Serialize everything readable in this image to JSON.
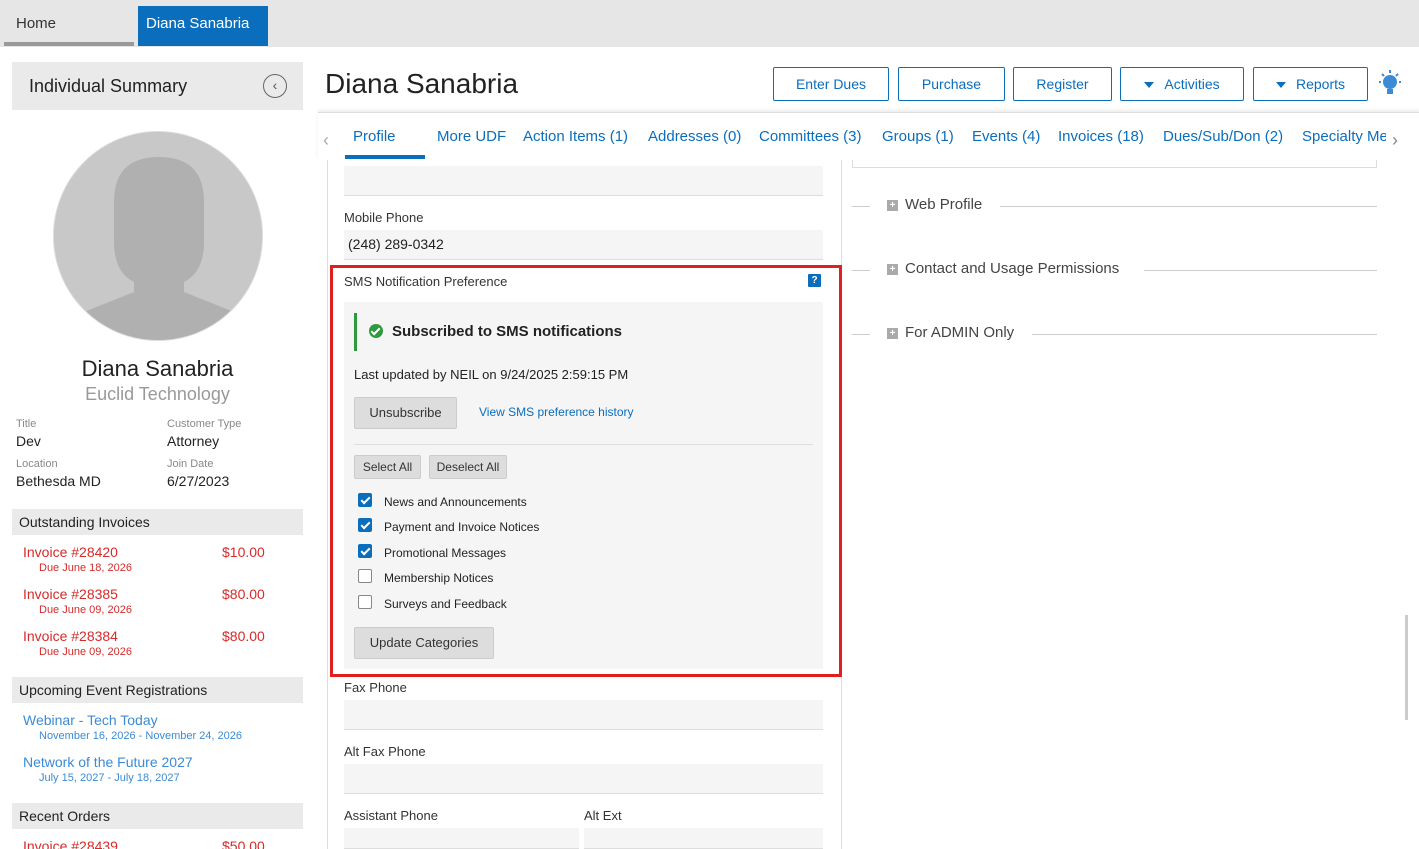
{
  "tabs_top": {
    "home": "Home",
    "active": "Diana Sanabria"
  },
  "summary": {
    "title": "Individual Summary",
    "name": "Diana Sanabria",
    "org": "Euclid Technology",
    "fields": {
      "title_label": "Title",
      "title_value": "Dev",
      "ctype_label": "Customer Type",
      "ctype_value": "Attorney",
      "location_label": "Location",
      "location_value": "Bethesda MD",
      "join_label": "Join Date",
      "join_value": "6/27/2023"
    },
    "invoices_head": "Outstanding Invoices",
    "invoices": [
      {
        "link": "Invoice #28420",
        "amount": "$10.00",
        "due": "Due June 18, 2026"
      },
      {
        "link": "Invoice #28385",
        "amount": "$80.00",
        "due": "Due June 09, 2026"
      },
      {
        "link": "Invoice #28384",
        "amount": "$80.00",
        "due": "Due June 09, 2026"
      }
    ],
    "events_head": "Upcoming Event Registrations",
    "events": [
      {
        "name": "Webinar - Tech Today",
        "dates": "November 16, 2026 - November 24, 2026"
      },
      {
        "name": "Network of the Future 2027",
        "dates": "July 15, 2027 - July 18, 2027"
      }
    ],
    "orders_head": "Recent Orders",
    "orders": [
      {
        "link": "Invoice #28439",
        "amount": "$50.00"
      }
    ]
  },
  "header": {
    "title": "Diana Sanabria",
    "buttons": {
      "enter_dues": "Enter Dues",
      "purchase": "Purchase",
      "register": "Register",
      "activities": "Activities",
      "reports": "Reports"
    }
  },
  "tabs": [
    "Profile",
    "More UDF",
    "Action Items (1)",
    "Addresses (0)",
    "Committees (3)",
    "Groups (1)",
    "Events (4)",
    "Invoices (18)",
    "Dues/Sub/Don (2)",
    "Specialty Me"
  ],
  "form": {
    "mobile_label": "Mobile Phone",
    "mobile_value": "(248) 289-0342",
    "sms_label": "SMS Notification Preference",
    "help": "?",
    "sms_status": "Subscribed to SMS notifications",
    "last_updated": "Last updated by NEIL on 9/24/2025 2:59:15 PM",
    "unsubscribe": "Unsubscribe",
    "history_link": "View SMS preference history",
    "select_all": "Select All",
    "deselect_all": "Deselect All",
    "categories": [
      {
        "label": "News and Announcements",
        "checked": true
      },
      {
        "label": "Payment and Invoice Notices",
        "checked": true
      },
      {
        "label": "Promotional Messages",
        "checked": true
      },
      {
        "label": "Membership Notices",
        "checked": false
      },
      {
        "label": "Surveys and Feedback",
        "checked": false
      }
    ],
    "update_categories": "Update Categories",
    "fax_label": "Fax Phone",
    "altfax_label": "Alt Fax Phone",
    "assistant_label": "Assistant Phone",
    "altext_label": "Alt Ext"
  },
  "right_sections": [
    "Web Profile",
    "Contact and Usage Permissions",
    "For ADMIN Only"
  ]
}
